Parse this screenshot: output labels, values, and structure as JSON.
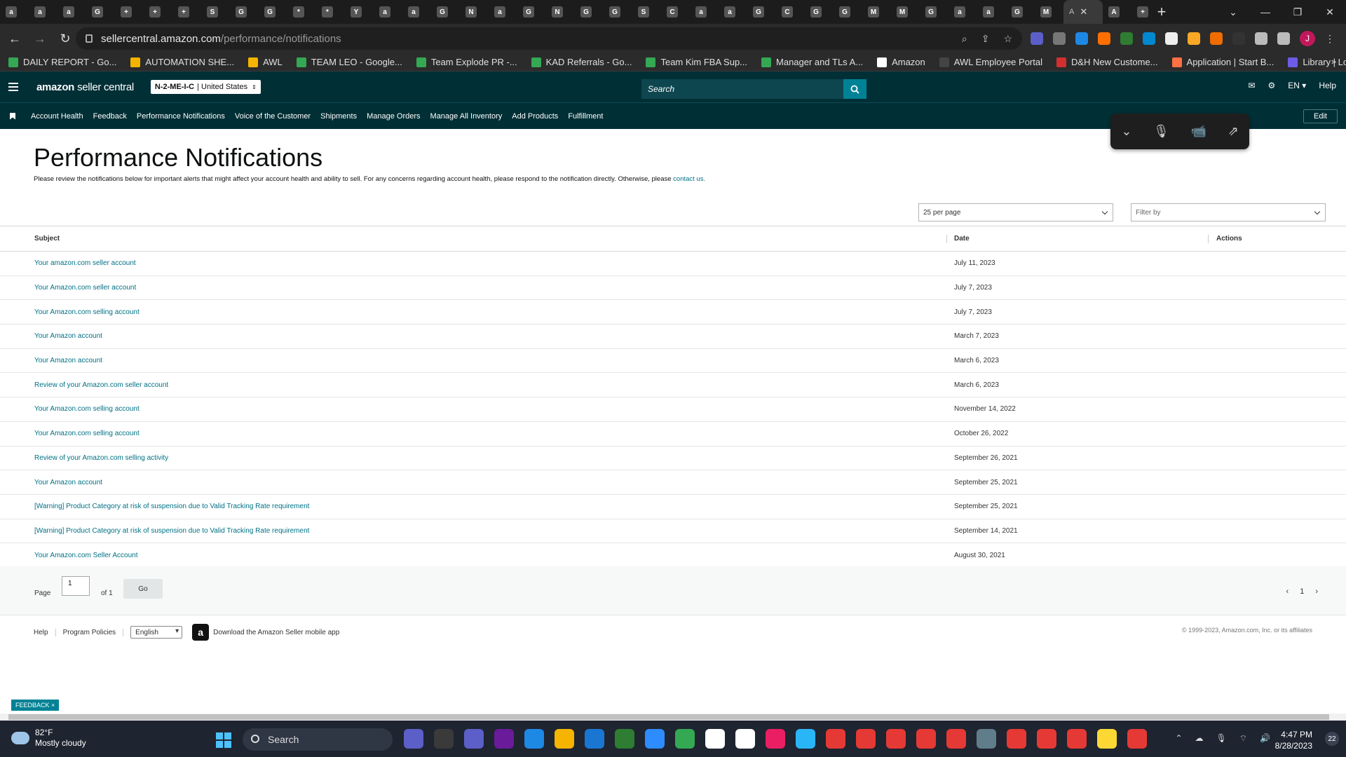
{
  "browser": {
    "tab_icons": [
      "a",
      "a",
      "a",
      "G",
      "+",
      "+",
      "+",
      "S",
      "G",
      "G",
      "*",
      "*",
      "Y",
      "a",
      "a",
      "G",
      "N",
      "a",
      "G",
      "N",
      "G",
      "G",
      "S",
      "C",
      "a",
      "a",
      "G",
      "C",
      "G",
      "G",
      "M",
      "M",
      "G",
      "a",
      "a",
      "G",
      "M",
      "A",
      "+"
    ],
    "active_tab_label": "A",
    "url_domain": "sellercentral.amazon.com",
    "url_path": "/performance/notifications",
    "profile_initial": "J",
    "bookmarks": [
      {
        "label": "DAILY REPORT - Go...",
        "color": "#34a853"
      },
      {
        "label": "AUTOMATION SHE...",
        "color": "#f4b400"
      },
      {
        "label": "AWL",
        "color": "#f4b400"
      },
      {
        "label": "TEAM LEO - Google...",
        "color": "#34a853"
      },
      {
        "label": "Team Explode PR -...",
        "color": "#34a853"
      },
      {
        "label": "KAD Referrals - Go...",
        "color": "#34a853"
      },
      {
        "label": "Team Kim FBA Sup...",
        "color": "#34a853"
      },
      {
        "label": "Manager and TLs A...",
        "color": "#34a853"
      },
      {
        "label": "Amazon",
        "color": "#ffffff"
      },
      {
        "label": "AWL Employee Portal",
        "color": "#444444"
      },
      {
        "label": "D&H New Custome...",
        "color": "#d32f2f"
      },
      {
        "label": "Application | Start B...",
        "color": "#ff7043"
      },
      {
        "label": "Library | Loom",
        "color": "#6c5ce7"
      }
    ]
  },
  "header": {
    "logo_bold": "amazon",
    "logo_thin": "seller central",
    "account_code": "N-2-ME-I-C",
    "account_region": "| United States",
    "search_placeholder": "Search",
    "language": "EN",
    "help": "Help"
  },
  "nav": {
    "items": [
      "Account Health",
      "Feedback",
      "Performance Notifications",
      "Voice of the Customer",
      "Shipments",
      "Manage Orders",
      "Manage All Inventory",
      "Add Products",
      "Fulfillment"
    ],
    "edit_label": "Edit"
  },
  "page": {
    "title": "Performance Notifications",
    "description": "Please review the notifications below for important alerts that might affect your account health and ability to sell. For any concerns regarding account health, please respond to the notification directly. Otherwise, please",
    "contact_link": "contact us.",
    "per_page": "25 per page",
    "filter_placeholder": "Filter by"
  },
  "table": {
    "headers": {
      "subject": "Subject",
      "date": "Date",
      "actions": "Actions"
    },
    "rows": [
      {
        "subject": "Your amazon.com seller account",
        "date": "July 11, 2023"
      },
      {
        "subject": "Your Amazon.com seller account",
        "date": "July 7, 2023"
      },
      {
        "subject": "Your Amazon.com selling account",
        "date": "July 7, 2023"
      },
      {
        "subject": "Your Amazon account",
        "date": "March 7, 2023"
      },
      {
        "subject": "Your Amazon account",
        "date": "March 6, 2023"
      },
      {
        "subject": "Review of your Amazon.com seller account",
        "date": "March 6, 2023"
      },
      {
        "subject": "Your Amazon.com selling account",
        "date": "November 14, 2022"
      },
      {
        "subject": "Your Amazon.com selling account",
        "date": "October 26, 2022"
      },
      {
        "subject": "Review of your Amazon.com selling activity",
        "date": "September 26, 2021"
      },
      {
        "subject": "Your Amazon account",
        "date": "September 25, 2021"
      },
      {
        "subject": "[Warning] Product Category at risk of suspension due to Valid Tracking Rate requirement",
        "date": "September 25, 2021"
      },
      {
        "subject": "[Warning] Product Category at risk of suspension due to Valid Tracking Rate requirement",
        "date": "September 14, 2021"
      },
      {
        "subject": "Your Amazon.com Seller Account",
        "date": "August 30, 2021"
      }
    ]
  },
  "pager": {
    "page_label": "Page",
    "page_value": "1",
    "of_label": "of 1",
    "go_label": "Go",
    "prev": "‹",
    "current": "1",
    "next": "›"
  },
  "footer": {
    "help": "Help",
    "program_policies": "Program Policies",
    "language": "English",
    "app_icon_letter": "a",
    "app_text": "Download the Amazon Seller mobile app",
    "copyright": "© 1999-2023, Amazon.com, Inc. or its affiliates"
  },
  "feedback_label": "FEEDBACK ×",
  "taskbar": {
    "temperature": "82°F",
    "weather": "Mostly cloudy",
    "search_label": "Search",
    "time": "4:47 PM",
    "date": "8/28/2023",
    "notification_count": "22",
    "app_colors": [
      "#5b5fc7",
      "#3a3a3a",
      "#5b5fc7",
      "#6a1b9a",
      "#1e88e5",
      "#f4b400",
      "#1976d2",
      "#2e7d32",
      "#2d8cff",
      "#34a853",
      "#ffffff",
      "#ffffff",
      "#e91e63",
      "#29b6f6",
      "#e53935",
      "#e53935",
      "#e53935",
      "#e53935",
      "#e53935",
      "#607d8b",
      "#e53935",
      "#e53935",
      "#e53935",
      "#fdd835",
      "#e53935"
    ]
  }
}
